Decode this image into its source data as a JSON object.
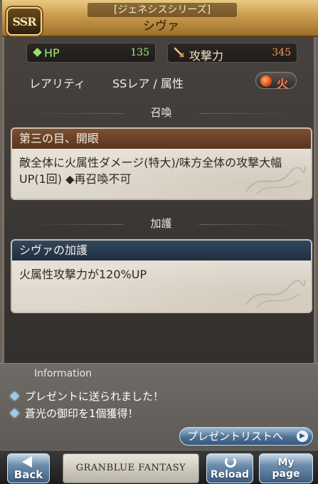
{
  "header": {
    "badge": "SSR",
    "series": "[ジェネシスシリーズ]",
    "name": "シヴァ"
  },
  "stats": {
    "hp_label": "HP",
    "hp_value": "135",
    "atk_label": "攻撃力",
    "atk_value": "345"
  },
  "rarity": {
    "label": "レアリティ",
    "value": "SSレア / 属性",
    "element": "火"
  },
  "summon_section": {
    "title": "召喚",
    "skill_name": "第三の目、開眼",
    "skill_desc": "敵全体に火属性ダメージ(特大)/味方全体の攻撃大幅UP(1回) ◆再召喚不可"
  },
  "aura_section": {
    "title": "加護",
    "skill_name": "シヴァの加護",
    "skill_desc": "火属性攻撃力が120%UP"
  },
  "info": {
    "title": "Information",
    "lines": [
      "プレゼントに送られました！",
      "蒼光の御印を1個獲得！"
    ],
    "present_button": "プレゼントリストへ"
  },
  "nav": {
    "back": "Back",
    "logo": "GRANBLUE FANTASY",
    "reload": "Reload",
    "mypage_line1": "My",
    "mypage_line2": "page"
  },
  "colors": {
    "header_gold": "#c99b4d",
    "hp_green": "#a7e77b",
    "atk_orange": "#f29a54",
    "fire_red": "#ff7b48",
    "summon_head": "#6a3f27",
    "aura_head": "#2a3d51",
    "button_blue": "#4d7194"
  }
}
